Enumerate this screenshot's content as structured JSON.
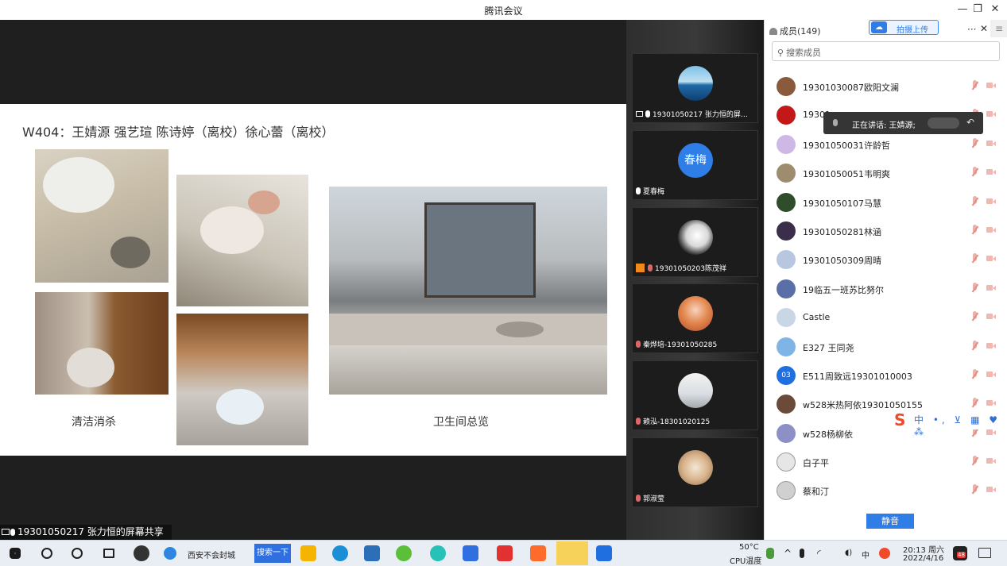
{
  "window": {
    "title": "腾讯会议",
    "min": "—",
    "restore": "❐",
    "close": "✕"
  },
  "slide": {
    "heading": "W404：王婧源 强艺瑄 陈诗婷（离校）徐心蕾（离校）",
    "caption_left": "清洁消杀",
    "caption_right": "卫生间总览"
  },
  "share_label": "19301050217 张力恒的屏幕共享",
  "video_tiles": [
    {
      "label": "19301050217 张力恒的屏幕...",
      "avatar": "ocean-avatar"
    },
    {
      "label": "夏春梅",
      "avatar_text": "春梅"
    },
    {
      "label": "19301050203陈茂祥",
      "avatar": "silhouette-avatar"
    },
    {
      "label": "秦烨培-19301050285",
      "avatar": "anime-avatar"
    },
    {
      "label": "赖泓-18301020125",
      "avatar": "room-avatar"
    },
    {
      "label": "郭淑莹",
      "avatar": "cat-avatar"
    }
  ],
  "panel": {
    "members_title": "成员(149)",
    "upload_label": "拍摄上传",
    "more": "···",
    "close": "✕",
    "menu": "≡",
    "search_placeholder": "搜索成员",
    "search_icon": "⚲"
  },
  "members": [
    {
      "name": "19301030087欧阳文澜",
      "color": "#8a5a3c"
    },
    {
      "name": "19301",
      "color": "#c21818"
    },
    {
      "name": "19301050031许龄哲",
      "color": "#cdb8e6"
    },
    {
      "name": "19301050051韦明爽",
      "color": "#9d8c6d"
    },
    {
      "name": "19301050107马慧",
      "color": "#2f4d2a"
    },
    {
      "name": "19301050281林涵",
      "color": "#3a2e4a"
    },
    {
      "name": "19301050309周晴",
      "color": "#b8c7e0"
    },
    {
      "name": "19临五一班苏比努尔",
      "color": "#5a6fa8"
    },
    {
      "name": "Castle",
      "color": "#c9d6e6"
    },
    {
      "name": "E327 王同尧",
      "color": "#7fb5e6"
    },
    {
      "name": "E511周致远19301010003",
      "color": "#1f6fe0",
      "text": "03"
    },
    {
      "name": "w528米热阿依19301050155",
      "color": "#6b4a3a"
    },
    {
      "name": "w528杨柳依",
      "color": "#8d8fc7"
    },
    {
      "name": "白子平",
      "color": "#e6e6e6"
    },
    {
      "name": "蔡和汀",
      "color": "#d0d0d0"
    }
  ],
  "speaking": {
    "text": "正在讲话: 王婧源;",
    "back_icon": "↶"
  },
  "ime": {
    "logo": "S",
    "items": "中 •, ⊻ ▦ ♥ ⁂"
  },
  "mute_button": "静音",
  "taskbar": {
    "search_text": "西安不会封城",
    "search_button": "搜索一下",
    "temperature": "50°C",
    "temp_label": "CPU温度",
    "time": "20:13 周六",
    "date": "2022/4/16",
    "notification_count": "48",
    "input_mode": "中"
  },
  "colors": {
    "accent": "#2f7de6",
    "panel_bg": "#ffffff",
    "stage_bg": "#1f1f1f"
  }
}
